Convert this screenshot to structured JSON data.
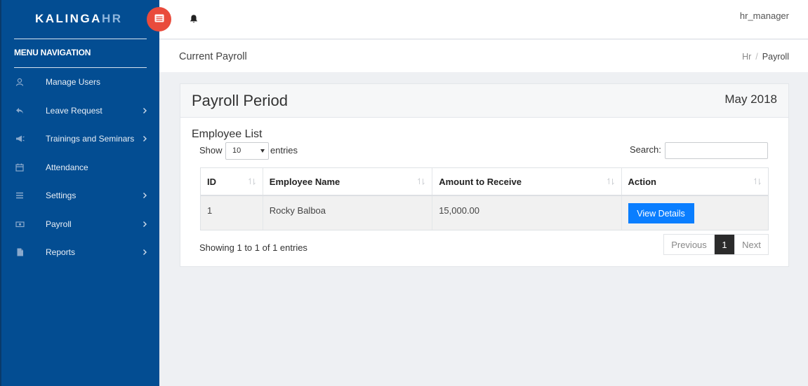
{
  "brand": {
    "main": "KALINGA",
    "accent": "HR"
  },
  "sidebar": {
    "heading": "MENU NAVIGATION",
    "items": [
      {
        "label": "Manage Users",
        "icon": "user-icon",
        "has_submenu": false
      },
      {
        "label": "Leave Request",
        "icon": "reply-icon",
        "has_submenu": true
      },
      {
        "label": "Trainings and Seminars",
        "icon": "megaphone-icon",
        "has_submenu": true
      },
      {
        "label": "Attendance",
        "icon": "calendar-icon",
        "has_submenu": false
      },
      {
        "label": "Settings",
        "icon": "list-icon",
        "has_submenu": true
      },
      {
        "label": "Payroll",
        "icon": "money-icon",
        "has_submenu": true
      },
      {
        "label": "Reports",
        "icon": "file-icon",
        "has_submenu": true
      }
    ]
  },
  "topbar": {
    "username": "hr_manager"
  },
  "page": {
    "title": "Current Payroll",
    "breadcrumb": [
      "Hr",
      "Payroll"
    ]
  },
  "card": {
    "title": "Payroll Period",
    "period": "May 2018",
    "section": "Employee List",
    "show_label": "Show",
    "entries_value": "10",
    "entries_label": "entries",
    "search_label": "Search:",
    "search_value": ""
  },
  "table": {
    "columns": [
      "ID",
      "Employee Name",
      "Amount to Receive",
      "Action"
    ],
    "rows": [
      {
        "id": "1",
        "name": "Rocky Balboa",
        "amount": "15,000.00",
        "action": "View Details"
      }
    ]
  },
  "footer": {
    "info": "Showing 1 to 1 of 1 entries",
    "prev": "Previous",
    "current": "1",
    "next": "Next"
  },
  "colors": {
    "sidebar": "#034d92",
    "toggle": "#e94b3c",
    "primary_button": "#0a7eff",
    "active_page": "#2b2b2b"
  }
}
